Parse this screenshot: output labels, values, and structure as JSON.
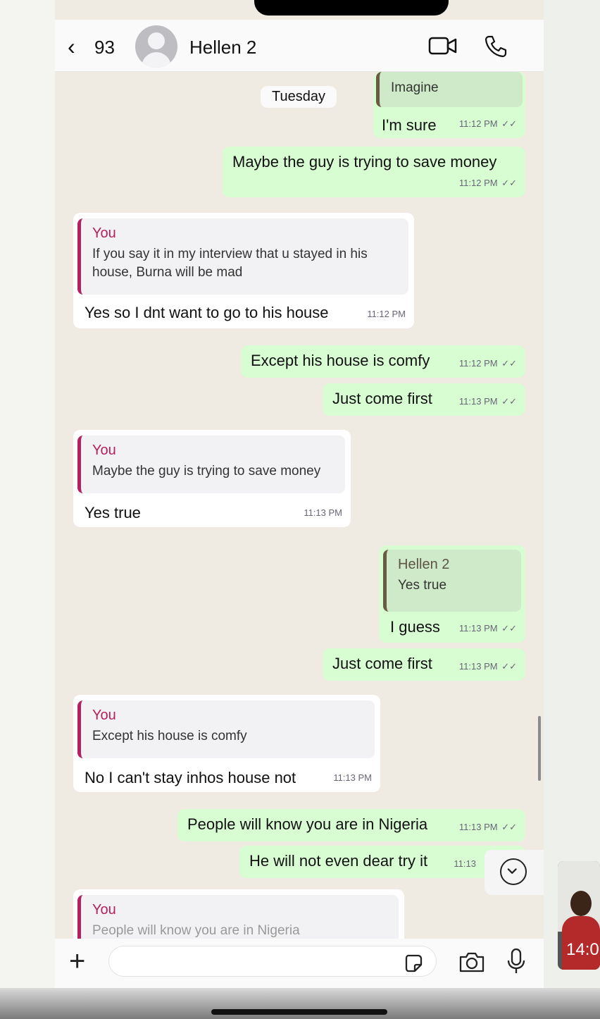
{
  "header": {
    "back_count": "93",
    "contact_name": "Hellen 2",
    "icons": [
      "chevron-left-icon",
      "avatar-icon",
      "video-call-icon",
      "phone-call-icon"
    ]
  },
  "day_separator": "Tuesday",
  "messages": [
    {
      "dir": "out",
      "quote_text": "Imagine",
      "text": "I'm sure",
      "time": "11:12 PM",
      "ticks": "✓✓"
    },
    {
      "dir": "out",
      "text": "Maybe the guy is trying to save money",
      "time": "11:12 PM",
      "ticks": "✓✓"
    },
    {
      "dir": "in",
      "quote_author": "You",
      "quote_text": "If you say it in my interview that u stayed in his house, Burna will be mad",
      "text": "Yes so I dnt want to go to his house",
      "time": "11:12 PM"
    },
    {
      "dir": "out",
      "text": "Except his house is comfy",
      "time": "11:12 PM",
      "ticks": "✓✓"
    },
    {
      "dir": "out",
      "text": "Just come first",
      "time": "11:13 PM",
      "ticks": "✓✓"
    },
    {
      "dir": "in",
      "quote_author": "You",
      "quote_text": "Maybe the guy is trying to save money",
      "text": "Yes true",
      "time": "11:13 PM"
    },
    {
      "dir": "out",
      "quote_author": "Hellen 2",
      "quote_text": "Yes true",
      "text": "I guess",
      "time": "11:13 PM",
      "ticks": "✓✓"
    },
    {
      "dir": "out",
      "text": "Just come first",
      "time": "11:13 PM",
      "ticks": "✓✓"
    },
    {
      "dir": "in",
      "quote_author": "You",
      "quote_text": "Except his house is comfy",
      "text": "No I can't stay inhos house not",
      "time": "11:13 PM"
    },
    {
      "dir": "out",
      "text": "People will know you are in Nigeria",
      "time": "11:13 PM",
      "ticks": "✓✓"
    },
    {
      "dir": "out",
      "text": "He will not even dear try it",
      "time": "11:13"
    },
    {
      "dir": "in",
      "quote_author": "You",
      "quote_text": "People will know you are in Nigeria"
    }
  ],
  "input": {
    "placeholder": ""
  },
  "pip_overlay": {
    "text": "14:0"
  },
  "colors": {
    "outgoing_bubble": "#d9fdd3",
    "incoming_bubble": "#ffffff",
    "quote_accent_you": "#b51f5d",
    "quote_accent_contact": "#6b5a43"
  }
}
